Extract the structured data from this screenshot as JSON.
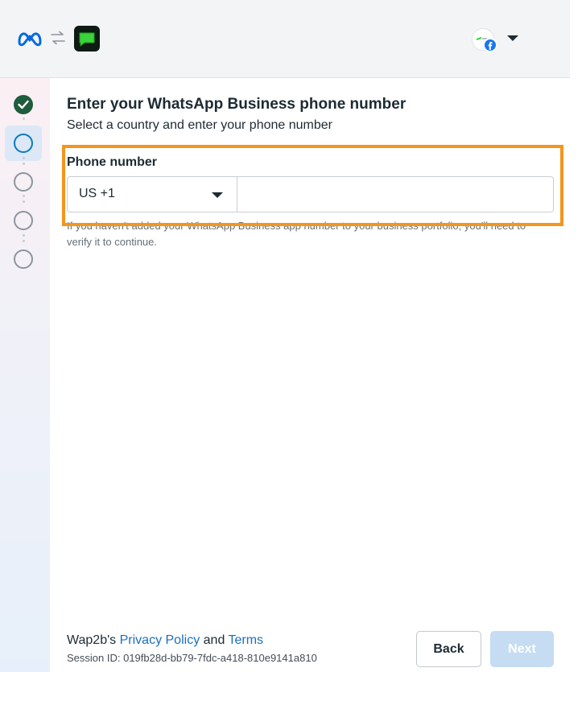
{
  "header": {
    "brand_icon": "meta-logo",
    "swap_icon": "swap-arrows-icon",
    "app_icon": "chat-bubble-icon",
    "account_icon": "facebook-icon"
  },
  "stepper": {
    "steps": [
      {
        "state": "done"
      },
      {
        "state": "current"
      },
      {
        "state": "pending"
      },
      {
        "state": "pending"
      },
      {
        "state": "pending"
      }
    ]
  },
  "main": {
    "title": "Enter your WhatsApp Business phone number",
    "subtitle": "Select a country and enter your phone number",
    "phone_label": "Phone number",
    "country_value": "US +1",
    "phone_value": "",
    "phone_placeholder": "",
    "help_text": "If you haven't added your WhatsApp Business app number to your business portfolio, you'll need to verify it to continue."
  },
  "footer": {
    "brand_prefix": "Wap2b's",
    "privacy_link": "Privacy Policy",
    "and_text": "and",
    "terms_link": "Terms",
    "session_label": "Session ID: 019fb28d-bb79-7fdc-a418-810e9141a810",
    "back_label": "Back",
    "next_label": "Next"
  },
  "colors": {
    "highlight": "#f4951c",
    "step_done": "#1f5c3d",
    "step_current": "#0a7ac0",
    "link": "#1a6ec0",
    "next_disabled": "#c5dcf3"
  }
}
